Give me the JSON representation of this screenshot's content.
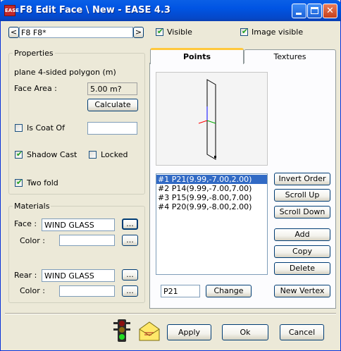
{
  "window": {
    "title": "F8 Edit Face \\ New - EASE 4.3",
    "app_icon_label": "EASE"
  },
  "nav": {
    "prev": "<",
    "next": ">",
    "face_name": "F8 F8*"
  },
  "top_checks": {
    "visible": {
      "label": "Visible",
      "checked": true
    },
    "image_visible": {
      "label": "Image visible",
      "checked": true
    }
  },
  "properties": {
    "group_title": "Properties",
    "type_text": "plane  4-sided polygon  (m)",
    "face_area_label": "Face Area :",
    "face_area_value": "5.00 m?",
    "calculate_button": "Calculate",
    "is_coat_of": {
      "label": "Is Coat Of",
      "checked": false,
      "value": ""
    },
    "shadow_cast": {
      "label": "Shadow Cast",
      "checked": true
    },
    "locked": {
      "label": "Locked",
      "checked": false
    },
    "two_fold": {
      "label": "Two fold",
      "checked": true
    }
  },
  "materials": {
    "group_title": "Materials",
    "face_label": "Face :",
    "face_value": "WIND GLASS",
    "face_color_label": "Color :",
    "face_color_value": "",
    "rear_label": "Rear :",
    "rear_value": "WIND GLASS",
    "rear_color_label": "Color :",
    "rear_color_value": "",
    "browse_label": "..."
  },
  "tabs": [
    {
      "label": "Points",
      "active": true
    },
    {
      "label": "Textures",
      "active": false
    }
  ],
  "points": {
    "items": [
      "#1  P21(9.99,-7.00,2.00)",
      "#2  P14(9.99,-7.00,7.00)",
      "#3  P15(9.99,-8.00,7.00)",
      "#4  P20(9.99,-8.00,2.00)"
    ],
    "selected_index": 0,
    "invert_order": "Invert Order",
    "scroll_up": "Scroll Up",
    "scroll_down": "Scroll Down",
    "add": "Add",
    "copy": "Copy",
    "delete": "Delete",
    "point_field": "P21",
    "change": "Change",
    "new_vertex": "New Vertex"
  },
  "footer": {
    "apply": "Apply",
    "ok": "Ok",
    "cancel": "Cancel"
  },
  "colors": {
    "title_bar": "#0054e3",
    "selection": "#316ac5",
    "window_bg": "#ece9d8",
    "axis_x": "#ff0000",
    "axis_y": "#00aa00",
    "axis_z": "#0000ff"
  },
  "icons": [
    "traffic-light-icon",
    "envelope-icon",
    "minimize-icon",
    "maximize-icon",
    "close-icon"
  ]
}
